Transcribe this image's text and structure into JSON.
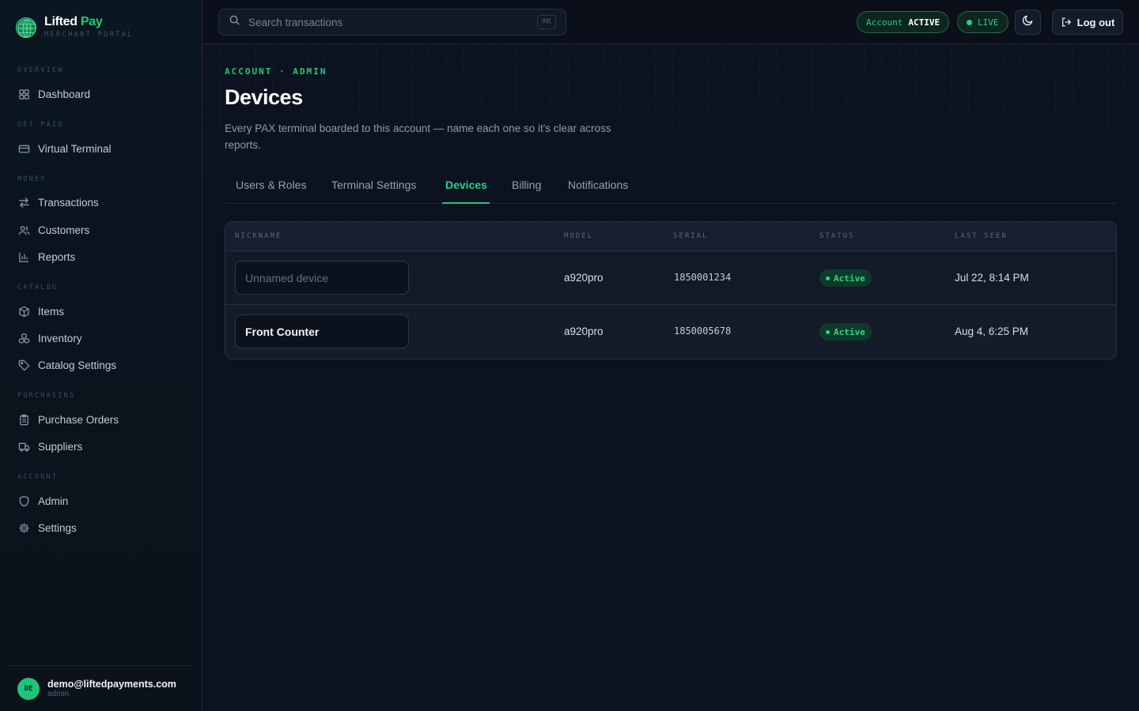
{
  "brand": {
    "name_part1": "Lifted",
    "name_part2": "Pay",
    "subtitle": "MERCHANT PORTAL"
  },
  "sidebar": {
    "sections": {
      "overview": "OVERVIEW",
      "get_paid": "GET PAID",
      "money": "MONEY",
      "catalog": "CATALOG",
      "purchasing": "PURCHASING",
      "account": "ACCOUNT"
    },
    "items": {
      "dashboard": "Dashboard",
      "virtual_terminal": "Virtual Terminal",
      "transactions": "Transactions",
      "customers": "Customers",
      "reports": "Reports",
      "items": "Items",
      "inventory": "Inventory",
      "catalog_settings": "Catalog Settings",
      "purchase_orders": "Purchase Orders",
      "suppliers": "Suppliers",
      "admin": "Admin",
      "settings": "Settings"
    },
    "user": {
      "initials": "DE",
      "email": "demo@liftedpayments.com",
      "role": "admin"
    }
  },
  "topbar": {
    "search_placeholder": "Search transactions",
    "search_shortcut": "⌘K",
    "account_label": "Account",
    "account_status": "ACTIVE",
    "mode": "LIVE",
    "logout_label": "Log out"
  },
  "page": {
    "eyebrow": "ACCOUNT · ADMIN",
    "title": "Devices",
    "description": "Every PAX terminal boarded to this account — name each one so it's clear across reports."
  },
  "tabs": [
    "Users & Roles",
    "Terminal Settings",
    "Devices",
    "Billing",
    "Notifications"
  ],
  "active_tab": "Devices",
  "table": {
    "headers": {
      "nickname": "NICKNAME",
      "model": "MODEL",
      "serial": "SERIAL",
      "status": "STATUS",
      "last_seen": "LAST SEEN"
    },
    "rows": [
      {
        "nickname": "",
        "nickname_placeholder": "Unnamed device",
        "model": "a920pro",
        "serial": "1850001234",
        "status": "Active",
        "last_seen": "Jul 22, 8:14 PM"
      },
      {
        "nickname": "Front Counter",
        "nickname_placeholder": "Unnamed device",
        "model": "a920pro",
        "serial": "1850005678",
        "status": "Active",
        "last_seen": "Aug 4, 6:25 PM"
      }
    ]
  },
  "colors": {
    "accent": "#22c97a",
    "background": "#0d1220",
    "sidebar": "#0b131d"
  },
  "icons": {
    "brand": "globe-icon",
    "dashboard": "grid-icon",
    "virtual_terminal": "credit-card-icon",
    "transactions": "arrows-swap-icon",
    "customers": "users-icon",
    "reports": "bar-chart-icon",
    "items": "box-icon",
    "inventory": "boxes-icon",
    "catalog_settings": "tag-icon",
    "purchase_orders": "clipboard-icon",
    "suppliers": "truck-icon",
    "admin": "shield-icon",
    "settings": "gear-icon",
    "search": "search-icon",
    "theme": "moon-icon",
    "logout": "logout-icon"
  }
}
